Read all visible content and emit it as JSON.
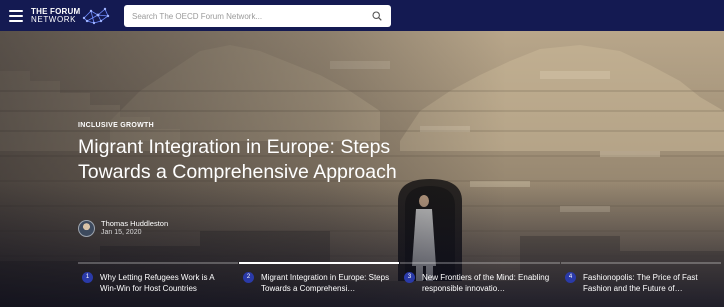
{
  "header": {
    "logo_top": "THE FORUM",
    "logo_bottom": "NETWORK",
    "search_placeholder": "Search The OECD Forum Network...",
    "colors": {
      "bar": "#141a52",
      "accent": "#2a3aa8"
    }
  },
  "hero": {
    "category": "INCLUSIVE GROWTH",
    "title": "Migrant Integration in Europe: Steps Towards a Comprehensive Approach",
    "author_name": "Thomas Huddleston",
    "date": "Jan 15, 2020"
  },
  "carousel": [
    {
      "num": "1",
      "title": "Why Letting Refugees Work is A Win-Win for Host Countries",
      "active": false
    },
    {
      "num": "2",
      "title": "Migrant Integration in Europe: Steps Towards a Comprehensi…",
      "active": true
    },
    {
      "num": "3",
      "title": "New Frontiers of the Mind: Enabling responsible innovatio…",
      "active": false
    },
    {
      "num": "4",
      "title": "Fashionopolis: The Price of Fast Fashion and the Future of…",
      "active": false
    }
  ],
  "icons": [
    "menu-icon",
    "network-logo-graphic",
    "search-icon",
    "avatar"
  ]
}
